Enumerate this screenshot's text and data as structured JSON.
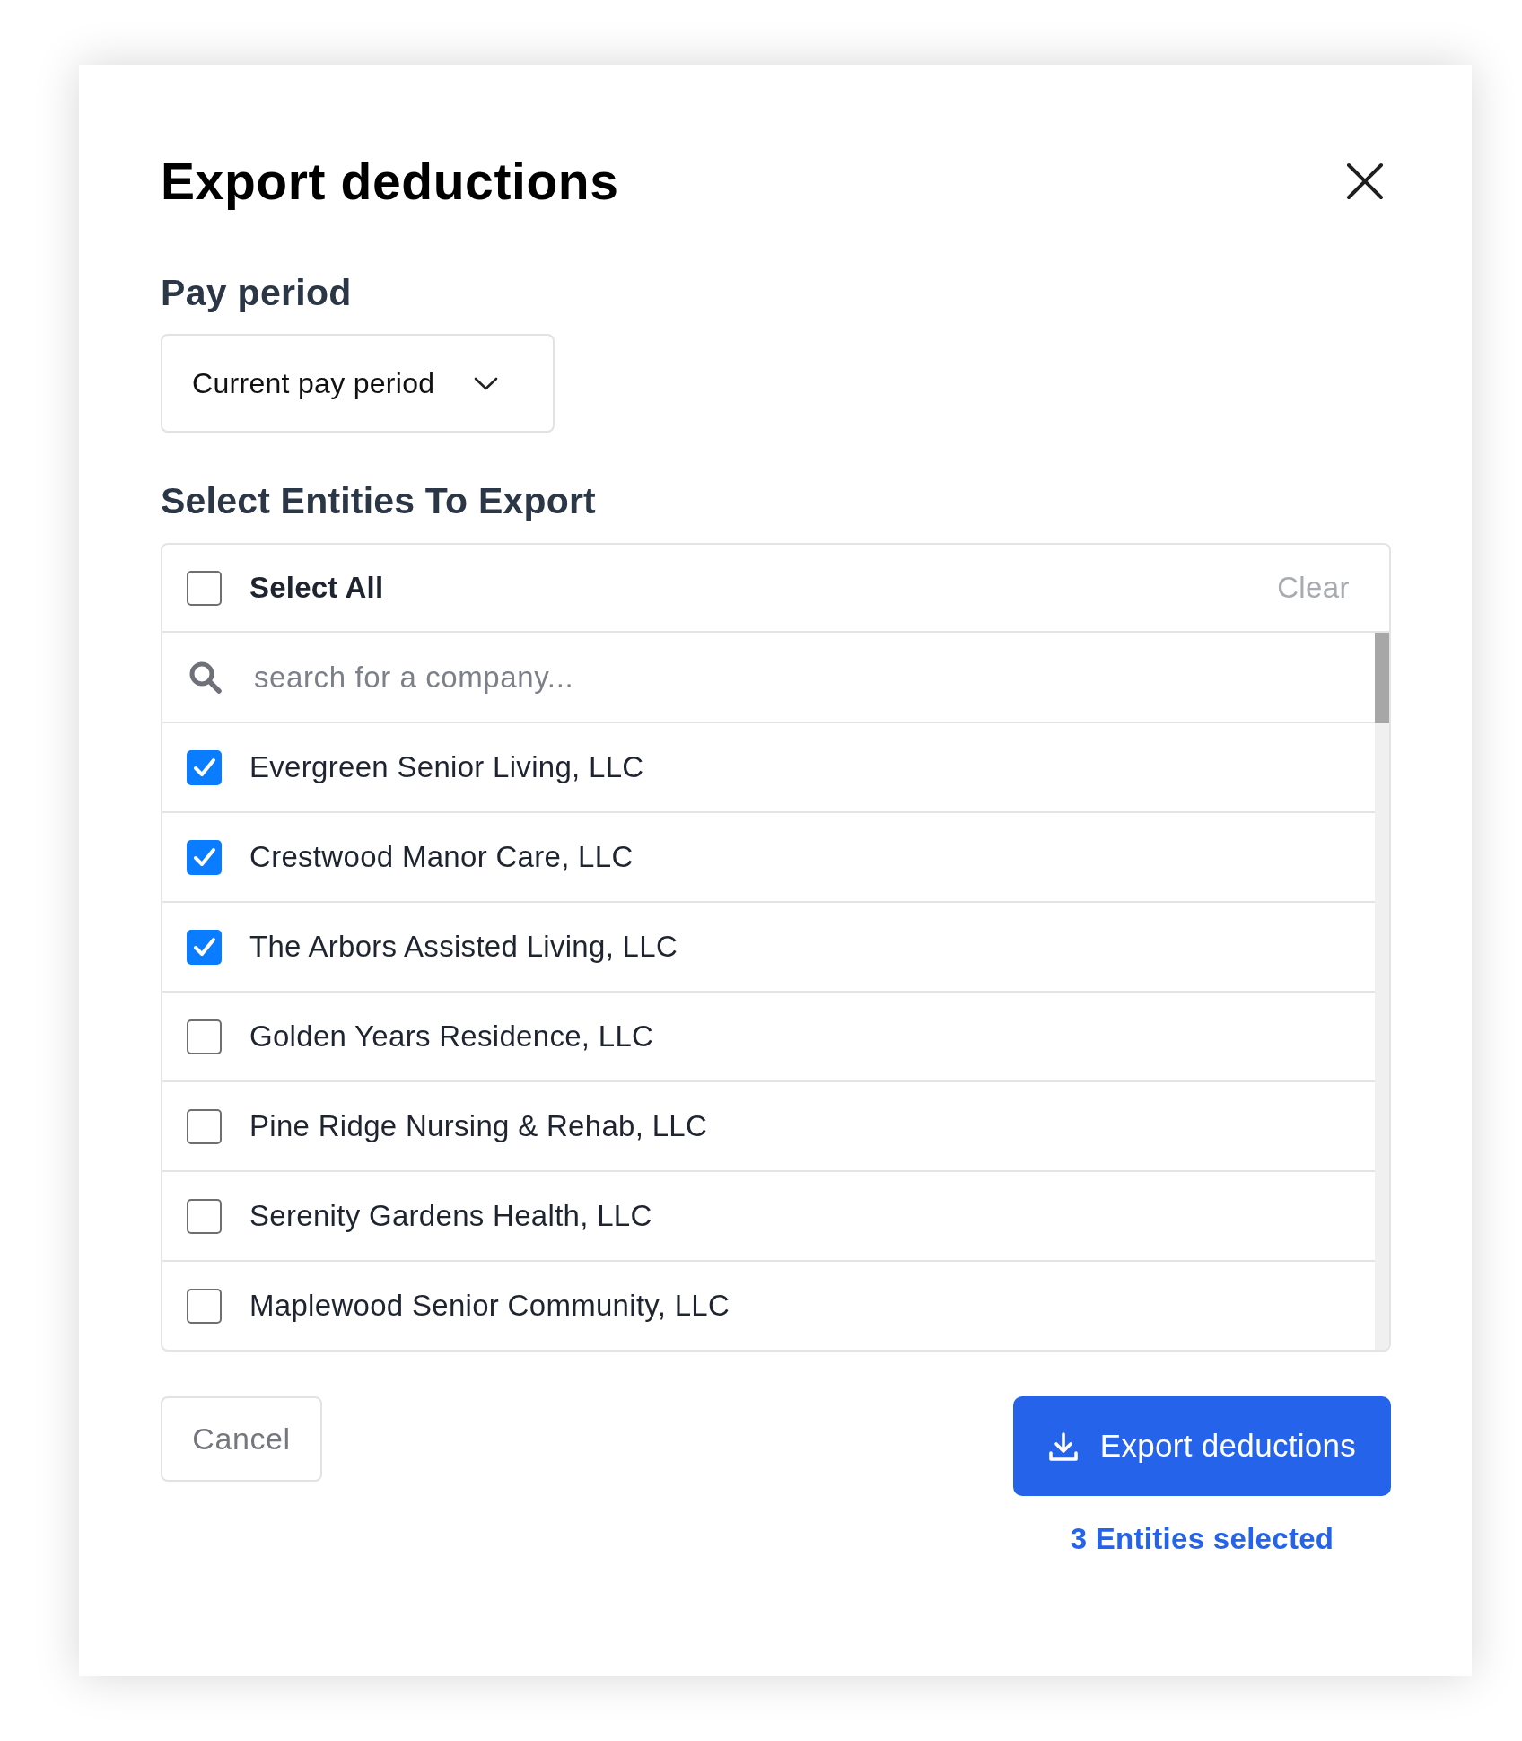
{
  "dialog": {
    "title": "Export deductions"
  },
  "pay_period": {
    "label": "Pay period",
    "dropdown": {
      "value": "Current pay period"
    }
  },
  "entities": {
    "heading": "Select Entities To Export",
    "select_all": {
      "label": "Select All",
      "checked": false
    },
    "clear": "Clear",
    "search": {
      "placeholder": "search for a company..."
    },
    "items": [
      {
        "name": "Evergreen Senior Living, LLC",
        "checked": true
      },
      {
        "name": "Crestwood Manor Care, LLC",
        "checked": true
      },
      {
        "name": "The Arbors Assisted Living, LLC",
        "checked": true
      },
      {
        "name": "Golden Years Residence, LLC",
        "checked": false
      },
      {
        "name": "Pine Ridge Nursing & Rehab, LLC",
        "checked": false
      },
      {
        "name": "Serenity Gardens Health, LLC",
        "checked": false
      },
      {
        "name": "Maplewood Senior Community, LLC",
        "checked": false
      }
    ]
  },
  "buttons": {
    "cancel": "Cancel",
    "export": "Export deductions"
  },
  "selection_summary": "3 Entities selected"
}
